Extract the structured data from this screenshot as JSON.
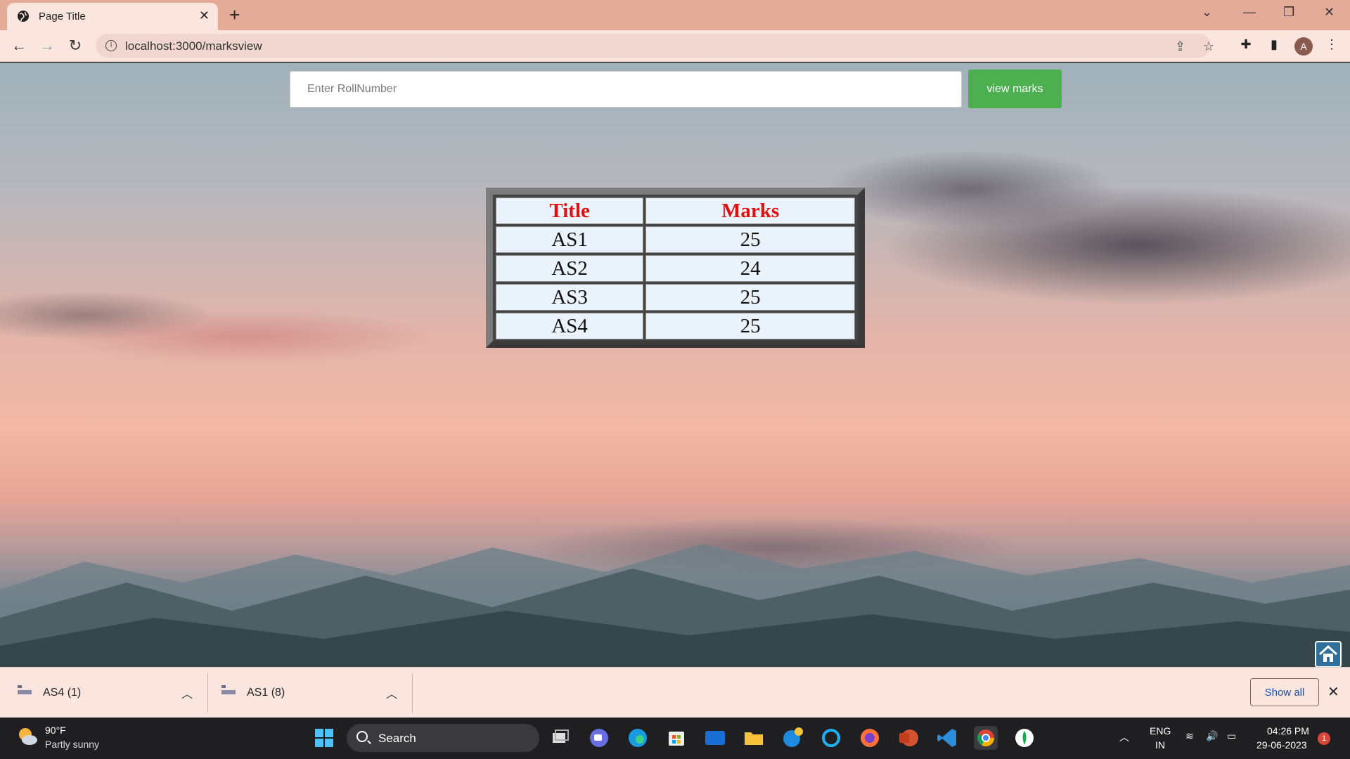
{
  "browser": {
    "tab_title": "Page Title",
    "url": "localhost:3000/marksview",
    "avatar_letter": "A"
  },
  "page": {
    "search_placeholder": "Enter RollNumber",
    "search_value": "",
    "view_button": "view marks",
    "table": {
      "headers": [
        "Title",
        "Marks"
      ],
      "rows": [
        [
          "AS1",
          "25"
        ],
        [
          "AS2",
          "24"
        ],
        [
          "AS3",
          "25"
        ],
        [
          "AS4",
          "25"
        ]
      ]
    }
  },
  "downloads": {
    "items": [
      {
        "name": "AS4 (1)"
      },
      {
        "name": "AS1 (8)"
      }
    ],
    "show_all": "Show all"
  },
  "taskbar": {
    "weather_temp": "90°F",
    "weather_desc": "Partly sunny",
    "search_label": "Search",
    "lang_top": "ENG",
    "lang_bottom": "IN",
    "time": "04:26 PM",
    "date": "29-06-2023",
    "notification_count": "1"
  },
  "colors": {
    "view_button": "#4caf50",
    "table_header_text": "#e01010",
    "chrome_frame": "#e4ab99"
  }
}
